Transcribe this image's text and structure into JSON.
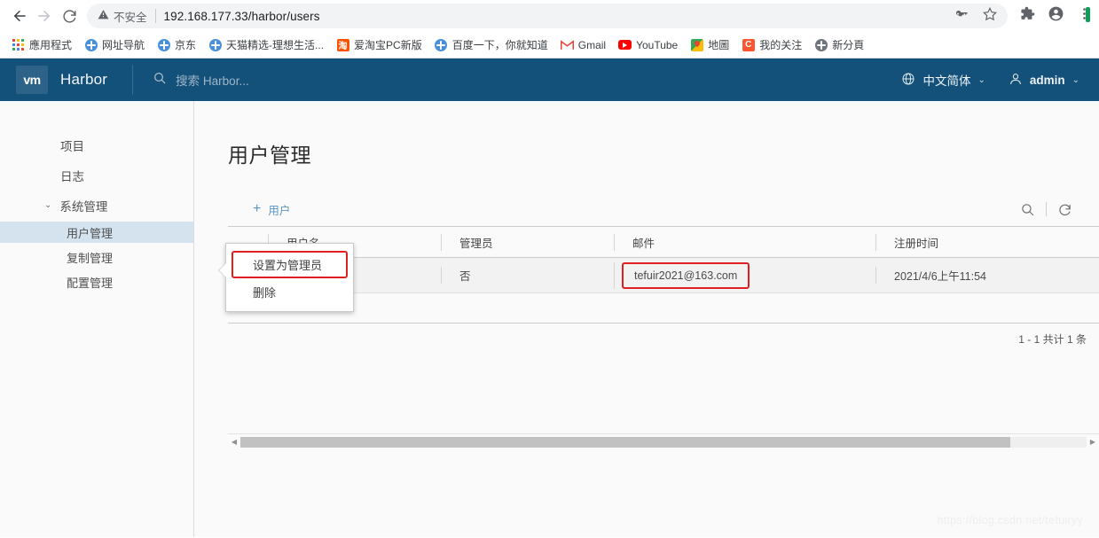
{
  "browser": {
    "back_icon": "arrow-left-icon",
    "forward_icon": "arrow-right-icon",
    "reload_icon": "reload-icon",
    "security_label": "不安全",
    "url": "192.168.177.33/harbor/users",
    "key_icon": "key-icon",
    "star_icon": "star-icon",
    "extensions_icon": "puzzle-icon",
    "profile_icon": "profile-avatar-icon",
    "menu_icon": "three-dot-menu-icon",
    "bookmarks": [
      {
        "label": "應用程式",
        "icon": "apps-grid-icon",
        "color": "#4285f4"
      },
      {
        "label": "网址导航",
        "icon": "globe-icon",
        "color": "#4a90d9"
      },
      {
        "label": "京东",
        "icon": "globe-icon",
        "color": "#4a90d9"
      },
      {
        "label": "天猫精选-理想生活...",
        "icon": "globe-icon",
        "color": "#4a90d9"
      },
      {
        "label": "爱淘宝PC新版",
        "icon": "taobao-icon",
        "color": "#ff5000",
        "glyph": "淘"
      },
      {
        "label": "百度一下，你就知道",
        "icon": "globe-icon",
        "color": "#4a90d9"
      },
      {
        "label": "Gmail",
        "icon": "gmail-icon",
        "color": "#ea4335",
        "glyph": "M"
      },
      {
        "label": "YouTube",
        "icon": "youtube-icon",
        "color": "#ff0000",
        "glyph": "▶"
      },
      {
        "label": "地圖",
        "icon": "maps-icon",
        "color": "#34a853",
        "glyph": "📍"
      },
      {
        "label": "我的关注",
        "icon": "csdn-icon",
        "color": "#fc5531",
        "glyph": "C"
      },
      {
        "label": "新分頁",
        "icon": "globe-icon",
        "color": "#5f6368"
      }
    ]
  },
  "header": {
    "logo_text": "vm",
    "brand": "Harbor",
    "search_placeholder": "搜索 Harbor...",
    "search_icon": "search-icon",
    "language": "中文简体",
    "language_icon": "globe-icon",
    "user": "admin",
    "user_icon": "user-avatar-icon",
    "caret": "⌄",
    "bg_color": "#13507a"
  },
  "sidebar": {
    "items": [
      {
        "label": "项目",
        "type": "item"
      },
      {
        "label": "日志",
        "type": "item"
      },
      {
        "label": "系统管理",
        "type": "group",
        "expanded": true
      }
    ],
    "subitems": [
      {
        "label": "用户管理",
        "active": true
      },
      {
        "label": "复制管理",
        "active": false
      },
      {
        "label": "配置管理",
        "active": false
      }
    ]
  },
  "main": {
    "page_title": "用户管理",
    "add_button": "用户",
    "add_icon": "plus-icon",
    "search_icon": "search-icon",
    "refresh_icon": "refresh-icon",
    "table": {
      "columns": [
        "用户名",
        "管理员",
        "邮件",
        "注册时间"
      ],
      "rows": [
        {
          "menu_icon": "vertical-dots-icon",
          "username": "",
          "admin": "否",
          "email": "tefuir2021@163.com",
          "created": "2021/4/6上午11:54"
        }
      ]
    },
    "pagination": "1 - 1 共计 1 条"
  },
  "context_menu": {
    "items": [
      {
        "label": "设置为管理员",
        "highlighted": true
      },
      {
        "label": "删除",
        "highlighted": false
      }
    ],
    "highlight_color": "#e02020"
  },
  "scrollbar": {
    "left_arrow": "◀",
    "right_arrow": "▶"
  },
  "watermark": "https://blog.csdn.net/tefuiryy"
}
